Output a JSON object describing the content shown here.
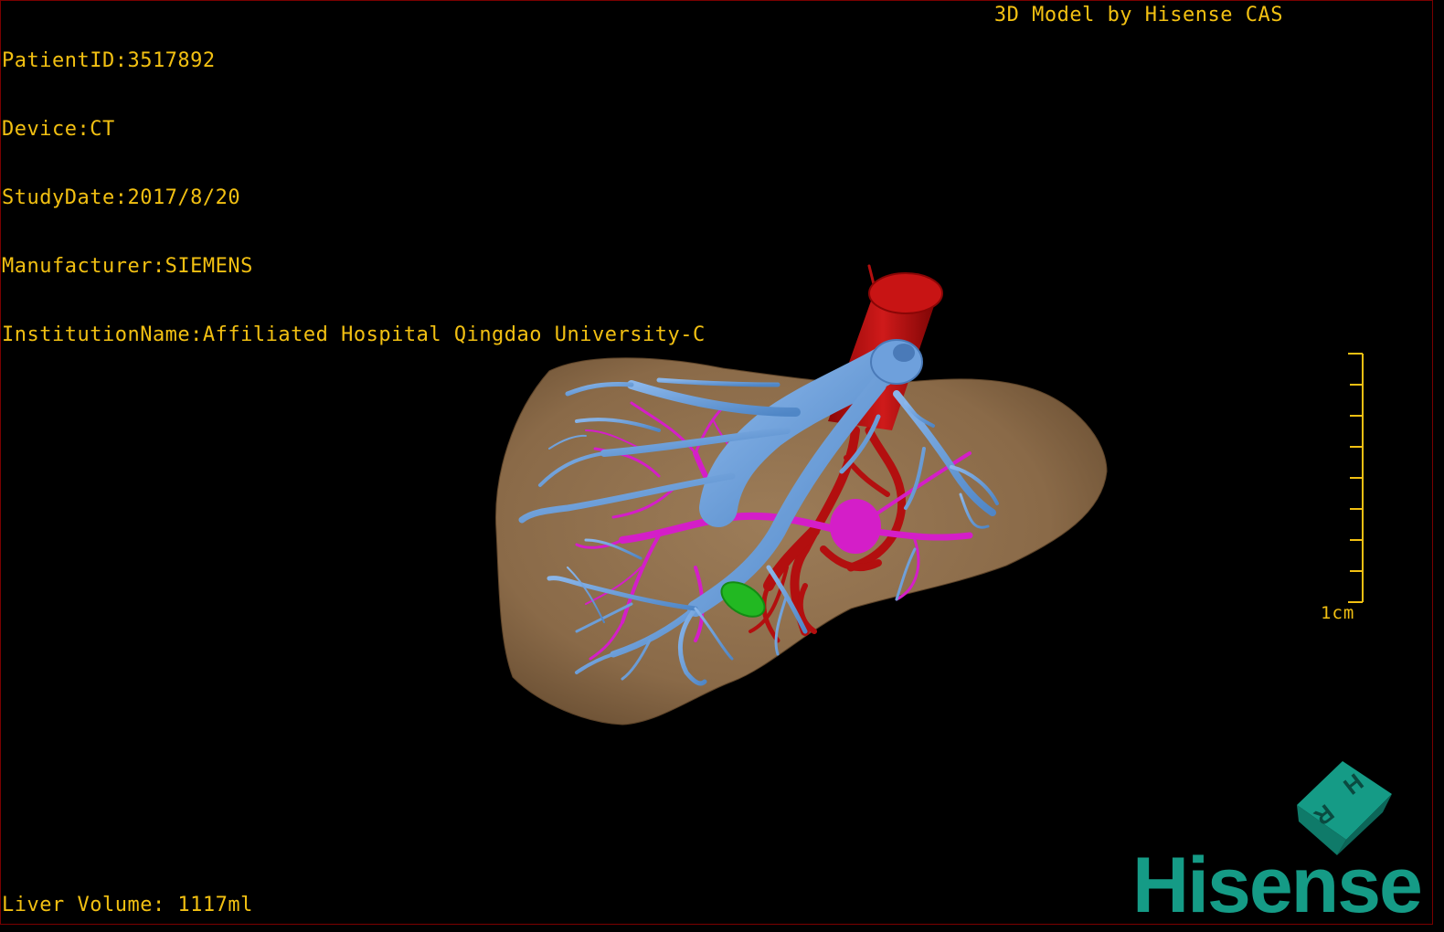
{
  "overlay": {
    "patient_id": "PatientID:3517892",
    "device": "Device:CT",
    "study_date": "StudyDate:2017/8/20",
    "manufacturer": "Manufacturer:SIEMENS",
    "institution": "InstitutionName:Affiliated Hospital Qingdao University-C",
    "watermark": "3D Model by Hisense CAS",
    "liver_volume": "Liver Volume: 1117ml"
  },
  "scale_bar": {
    "label": "1cm"
  },
  "orientation_cube": {
    "face_letters": [
      "H",
      "R"
    ],
    "icon": "orientation-cube-icon"
  },
  "brand": {
    "name": "Hisense"
  },
  "colors": {
    "text": "#f2c012",
    "liver": "#8d6e4e",
    "hepatic_vein": "#6ea0dc",
    "portal_vein": "#d41ec8",
    "artery": "#b30f0f",
    "gallbladder": "#22b822",
    "brand": "#159b86"
  }
}
